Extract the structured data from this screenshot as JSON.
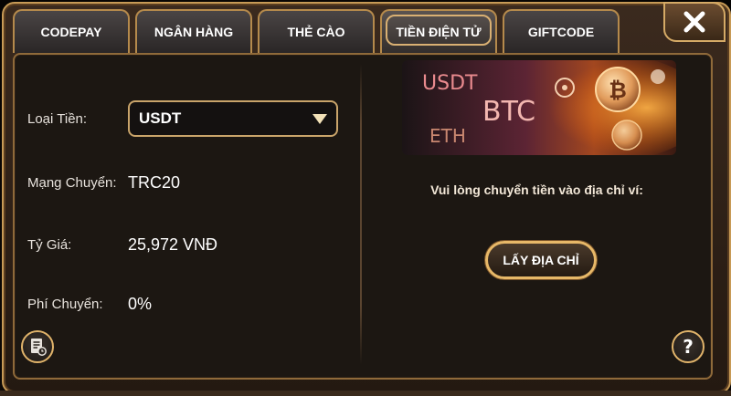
{
  "tabs": [
    {
      "label": "CODEPAY",
      "active": false
    },
    {
      "label": "NGÂN HÀNG",
      "active": false
    },
    {
      "label": "THẺ CÀO",
      "active": false
    },
    {
      "label": "TIỀN ĐIỆN TỬ",
      "active": true
    },
    {
      "label": "GIFTCODE",
      "active": false
    }
  ],
  "close_icon": "close-icon",
  "form": {
    "currency_label": "Loại Tiền:",
    "currency_value": "USDT",
    "network_label": "Mạng Chuyển:",
    "network_value": "TRC20",
    "rate_label": "Tỷ Giá:",
    "rate_value": "25,972 VNĐ",
    "fee_label": "Phí Chuyển:",
    "fee_value": "0%"
  },
  "banner": {
    "usdt": "USDT",
    "btc": "BTC",
    "eth": "ETH"
  },
  "instruction": "Vui lòng chuyển tiền vào địa chỉ ví:",
  "get_address_button": "LẤY ĐỊA CHỈ",
  "icons": {
    "history": "history-icon",
    "help": "help-icon"
  },
  "colors": {
    "accent_gold": "#d5aa66",
    "panel_bg": "#1c1712"
  }
}
